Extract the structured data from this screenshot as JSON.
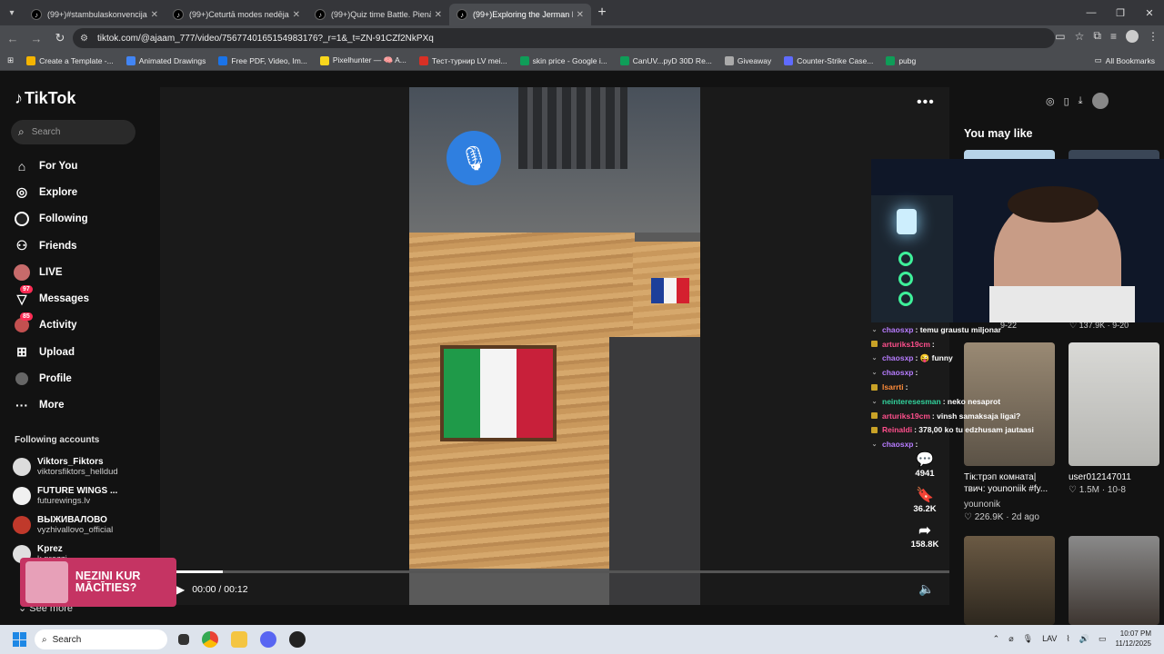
{
  "browser": {
    "tabs": [
      {
        "title": "(99+)#stambulaskonvencija | Ti",
        "active": false
      },
      {
        "title": "(99+)Ceturtā modes nedējas di",
        "active": false
      },
      {
        "title": "(99+)Quiz time Battle. Pienācin",
        "active": false
      },
      {
        "title": "(99+)Exploring the Jerman Filte",
        "active": true
      }
    ],
    "url": "tiktok.com/@ajaam_777/video/7567740165154983176?_r=1&_t=ZN-91CZf2NkPXq",
    "bookmarks": [
      {
        "label": "Create a Template -...",
        "color": "#f4b400"
      },
      {
        "label": "Animated Drawings",
        "color": "#4285f4"
      },
      {
        "label": "Free PDF, Video, Im...",
        "color": "#1a73e8"
      },
      {
        "label": "Pixelhunter — 🧠 A...",
        "color": "#f9d71c"
      },
      {
        "label": "Тест-турнир LV mei...",
        "color": "#d93025"
      },
      {
        "label": "skin price - Google i...",
        "color": "#0f9d58"
      },
      {
        "label": "CanUV...pyD 30D Re...",
        "color": "#0f9d58"
      },
      {
        "label": "Giveaway",
        "color": "#aaaaaa"
      },
      {
        "label": "Counter-Strike Case...",
        "color": "#5f6bff"
      },
      {
        "label": "pubg",
        "color": "#0f9d58"
      }
    ],
    "all_bookmarks": "All Bookmarks"
  },
  "tiktok": {
    "logo": "TikTok",
    "search_placeholder": "Search",
    "nav": [
      {
        "label": "For You",
        "icon": "home-icon"
      },
      {
        "label": "Explore",
        "icon": "compass-icon"
      },
      {
        "label": "Following",
        "icon": "following-icon"
      },
      {
        "label": "Friends",
        "icon": "friends-icon"
      },
      {
        "label": "LIVE",
        "icon": "live-icon"
      },
      {
        "label": "Messages",
        "icon": "messages-icon",
        "badge": "97"
      },
      {
        "label": "Activity",
        "icon": "activity-icon",
        "badge": "85"
      },
      {
        "label": "Upload",
        "icon": "upload-icon"
      },
      {
        "label": "Profile",
        "icon": "profile-icon"
      },
      {
        "label": "More",
        "icon": "more-icon"
      }
    ],
    "following_accounts_title": "Following accounts",
    "accounts": [
      {
        "name": "Viktors_Fiktors",
        "user": "viktorsfiktors_helldud"
      },
      {
        "name": "FUTURE WINGS ...",
        "user": "futurewings.lv"
      },
      {
        "name": "ВЫЖИВАЛОВО",
        "user": "vyzhivallovo_official"
      },
      {
        "name": "Kprez",
        "user": "k.prezzi"
      }
    ],
    "see_more": "See more",
    "promo": "NEZINI KUR MĀCĪTIES?",
    "video": {
      "time": "00:00 / 00:12",
      "progress": 0.06
    },
    "actions": [
      {
        "icon": "comment-icon",
        "count": "4941"
      },
      {
        "icon": "bookmark-icon",
        "count": "36.2K"
      },
      {
        "icon": "share-icon",
        "count": "158.8K"
      }
    ],
    "you_may_like": "You may like",
    "suggestions": [
      {
        "caption": "",
        "author": "",
        "likes": "",
        "date": "9-22"
      },
      {
        "caption": "",
        "author": "",
        "likes": "137.9K",
        "date": "9-20"
      },
      {
        "caption": "Тік:трэп комната| твич: younoniik #fy...",
        "author": "younonik",
        "likes": "226.9K",
        "date": "2d ago"
      },
      {
        "caption": "user012147011",
        "author": "",
        "likes": "1.5M",
        "date": "10-8"
      }
    ],
    "creator": "ajaam_777"
  },
  "chat": [
    {
      "badge": "chevron",
      "user": "chaosxp",
      "ucls": "u-purple",
      "msg": ": temu graustu miljonar"
    },
    {
      "badge": "gold",
      "user": "arturiks19cm",
      "ucls": "u-pink",
      "msg": ":"
    },
    {
      "badge": "chevron",
      "user": "chaosxp",
      "ucls": "u-purple",
      "msg": ": 😜 funny"
    },
    {
      "badge": "chevron",
      "user": "chaosxp",
      "ucls": "u-purple",
      "msg": ":"
    },
    {
      "badge": "gold",
      "user": "lsarrti",
      "ucls": "u-orange",
      "msg": ":"
    },
    {
      "badge": "chevron",
      "user": "neinteresesman",
      "ucls": "u-green",
      "msg": ": neko nesaprot"
    },
    {
      "badge": "gold",
      "user": "arturiks19cm",
      "ucls": "u-pink",
      "msg": ": vinsh samaksaja ligai?"
    },
    {
      "badge": "gold",
      "user": "Reinaldi",
      "ucls": "u-pink",
      "msg": ": 378,00 ko tu edzhusam jautaasi"
    },
    {
      "badge": "chevron",
      "user": "chaosxp",
      "ucls": "u-purple",
      "msg": ":"
    }
  ],
  "taskbar": {
    "search": "Search",
    "lang": "LAV",
    "time": "10:07 PM",
    "date": "11/12/2025"
  }
}
